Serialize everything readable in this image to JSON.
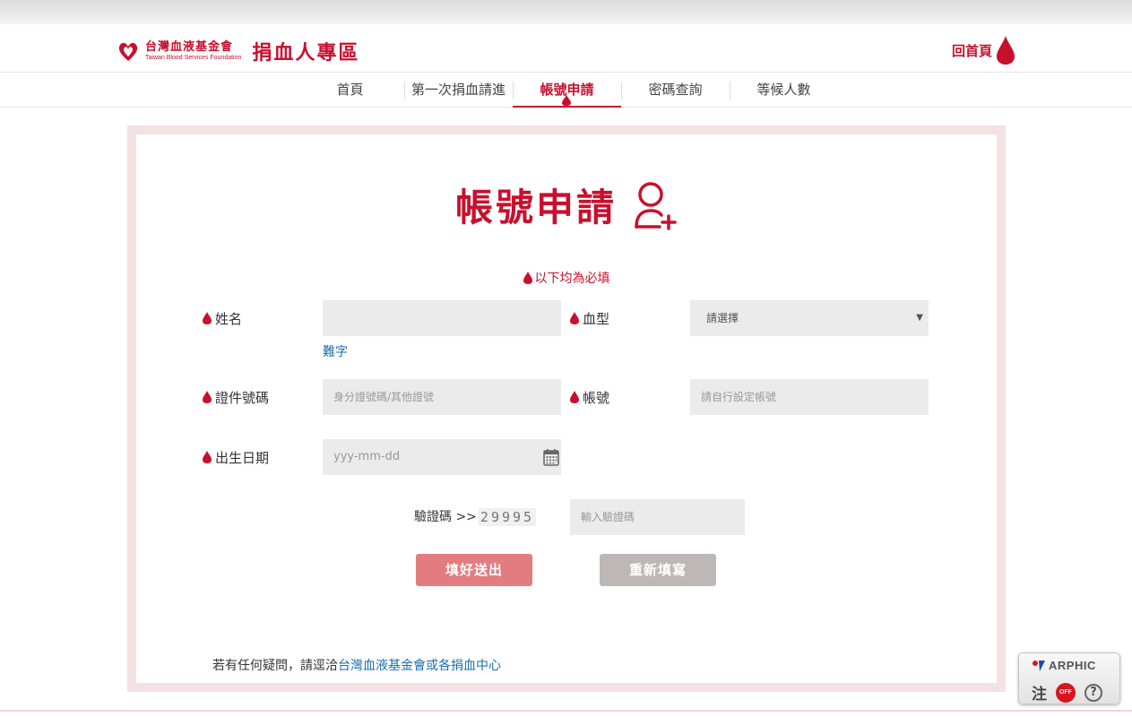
{
  "header": {
    "org_name": "台灣血液基金會",
    "org_name_en": "Taiwan Blood Services Foundation",
    "zone_title": "捐血人專區",
    "home_label": "回首頁"
  },
  "nav": {
    "items": [
      {
        "label": "首頁"
      },
      {
        "label": "第一次捐血請進"
      },
      {
        "label": "帳號申請"
      },
      {
        "label": "密碼查詢"
      },
      {
        "label": "等候人數"
      }
    ],
    "active": "帳號申請"
  },
  "form": {
    "title": "帳號申請",
    "required_note": "以下均為必填",
    "name_label": "姓名",
    "name_value": "",
    "rare_char_link": "難字",
    "blood_type_label": "血型",
    "blood_type_value": "請選擇",
    "id_label": "證件號碼",
    "id_placeholder": "身分證號碼/其他證號",
    "account_label": "帳號",
    "account_placeholder": "請自行設定帳號",
    "birth_label": "出生日期",
    "birth_placeholder": "yyy-mm-dd",
    "captcha_label": "驗證碼 >>",
    "captcha_code": "29995",
    "captcha_placeholder": "輸入驗證碼",
    "submit_label": "填好送出",
    "reset_label": "重新填寫"
  },
  "footer": {
    "note_prefix": "若有任何疑問，請逕洽",
    "note_link": "台灣血液基金會或各捐血中心"
  },
  "arphic": {
    "brand": "ARPHIC",
    "zhu": "注",
    "off": "OFF",
    "help": "?"
  },
  "colors": {
    "brand_red": "#c8102e",
    "frame_pink": "#f4e1e1",
    "submit": "#e37c80",
    "reset": "#bdb8b5",
    "link_blue": "#1a6fb0"
  }
}
